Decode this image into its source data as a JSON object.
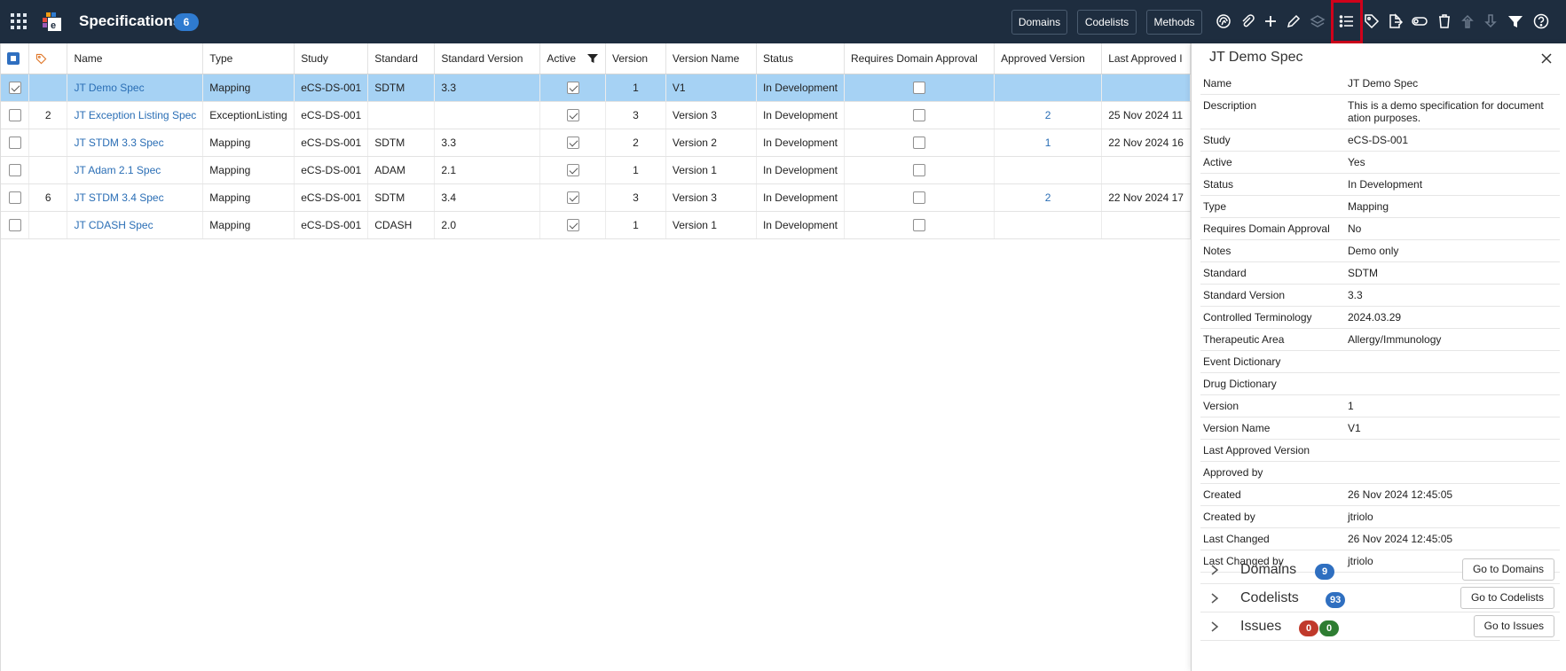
{
  "app": {
    "title": "Specifications",
    "count": "6"
  },
  "nav_buttons": [
    "Domains",
    "Codelists",
    "Methods"
  ],
  "toolbar_icons": [
    "fingerprint-icon",
    "paperclip-icon",
    "plus-icon",
    "pencil-icon",
    "layers-icon",
    "list-icon",
    "tag-icon",
    "export-icon",
    "toggle-icon",
    "trash-icon",
    "arrow-up-icon",
    "arrow-down-icon",
    "filter-clear-icon",
    "help-icon"
  ],
  "grid": {
    "columns": [
      "Name",
      "Type",
      "Study",
      "Standard",
      "Standard Version",
      "Active",
      "Version",
      "Version Name",
      "Status",
      "Requires Domain Approval",
      "Approved Version",
      "Last Approved I"
    ],
    "rows": [
      {
        "tag": "",
        "name": "JT Demo Spec",
        "type": "Mapping",
        "study": "eCS-DS-001",
        "standard": "SDTM",
        "std_version": "3.3",
        "active": true,
        "version": "1",
        "version_name": "V1",
        "status": "In Development",
        "requires_approval": false,
        "approved_version": "",
        "last_approved": "",
        "selected": true
      },
      {
        "tag": "2",
        "name": "JT Exception Listing Spec",
        "type": "ExceptionListing",
        "study": "eCS-DS-001",
        "standard": "",
        "std_version": "",
        "active": true,
        "version": "3",
        "version_name": "Version 3",
        "status": "In Development",
        "requires_approval": false,
        "approved_version": "2",
        "last_approved": "25 Nov 2024 11",
        "selected": false
      },
      {
        "tag": "",
        "name": "JT STDM 3.3 Spec",
        "type": "Mapping",
        "study": "eCS-DS-001",
        "standard": "SDTM",
        "std_version": "3.3",
        "active": true,
        "version": "2",
        "version_name": "Version 2",
        "status": "In Development",
        "requires_approval": false,
        "approved_version": "1",
        "last_approved": "22 Nov 2024 16",
        "selected": false
      },
      {
        "tag": "",
        "name": "JT Adam 2.1 Spec",
        "type": "Mapping",
        "study": "eCS-DS-001",
        "standard": "ADAM",
        "std_version": "2.1",
        "active": true,
        "version": "1",
        "version_name": "Version 1",
        "status": "In Development",
        "requires_approval": false,
        "approved_version": "",
        "last_approved": "",
        "selected": false
      },
      {
        "tag": "6",
        "name": "JT STDM 3.4 Spec",
        "type": "Mapping",
        "study": "eCS-DS-001",
        "standard": "SDTM",
        "std_version": "3.4",
        "active": true,
        "version": "3",
        "version_name": "Version 3",
        "status": "In Development",
        "requires_approval": false,
        "approved_version": "2",
        "last_approved": "22 Nov 2024 17",
        "selected": false
      },
      {
        "tag": "",
        "name": "JT CDASH Spec",
        "type": "Mapping",
        "study": "eCS-DS-001",
        "standard": "CDASH",
        "std_version": "2.0",
        "active": true,
        "version": "1",
        "version_name": "Version 1",
        "status": "In Development",
        "requires_approval": false,
        "approved_version": "",
        "last_approved": "",
        "selected": false
      }
    ]
  },
  "panel": {
    "title": "JT Demo Spec",
    "properties": [
      {
        "key": "Name",
        "value": "JT Demo Spec"
      },
      {
        "key": "Description",
        "value": "This is a demo specification for document ation purposes."
      },
      {
        "key": "Study",
        "value": "eCS-DS-001"
      },
      {
        "key": "Active",
        "value": "Yes"
      },
      {
        "key": "Status",
        "value": "In Development"
      },
      {
        "key": "Type",
        "value": "Mapping"
      },
      {
        "key": "Requires Domain Approval",
        "value": "No"
      },
      {
        "key": "Notes",
        "value": "Demo only"
      },
      {
        "key": "Standard",
        "value": "SDTM"
      },
      {
        "key": "Standard Version",
        "value": "3.3"
      },
      {
        "key": "Controlled Terminology",
        "value": "2024.03.29"
      },
      {
        "key": "Therapeutic Area",
        "value": "Allergy/Immunology"
      },
      {
        "key": "Event Dictionary",
        "value": ""
      },
      {
        "key": "Drug Dictionary",
        "value": ""
      },
      {
        "key": "Version",
        "value": "1"
      },
      {
        "key": "Version Name",
        "value": "V1"
      },
      {
        "key": "Last Approved Version",
        "value": ""
      },
      {
        "key": "Approved by",
        "value": ""
      },
      {
        "key": "Created",
        "value": "26 Nov 2024 12:45:05"
      },
      {
        "key": "Created by",
        "value": "jtriolo"
      },
      {
        "key": "Last Changed",
        "value": "26 Nov 2024 12:45:05"
      },
      {
        "key": "Last Changed by",
        "value": "jtriolo"
      }
    ],
    "sections": [
      {
        "label": "Domains",
        "badges": [
          {
            "text": "9",
            "color": "#2f6fc0"
          }
        ],
        "button": "Go to Domains"
      },
      {
        "label": "Codelists",
        "badges": [
          {
            "text": "93",
            "color": "#2f6fc0"
          }
        ],
        "button": "Go to Codelists"
      },
      {
        "label": "Issues",
        "badges": [
          {
            "text": "0",
            "color": "#c0392b"
          },
          {
            "text": "0",
            "color": "#2e7d32"
          }
        ],
        "button": "Go to Issues"
      }
    ]
  },
  "colors": {
    "topbar": "#1e2d3f",
    "selected_row": "#a6d2f4",
    "link": "#2a6eb5",
    "highlight": "#d0021b"
  }
}
